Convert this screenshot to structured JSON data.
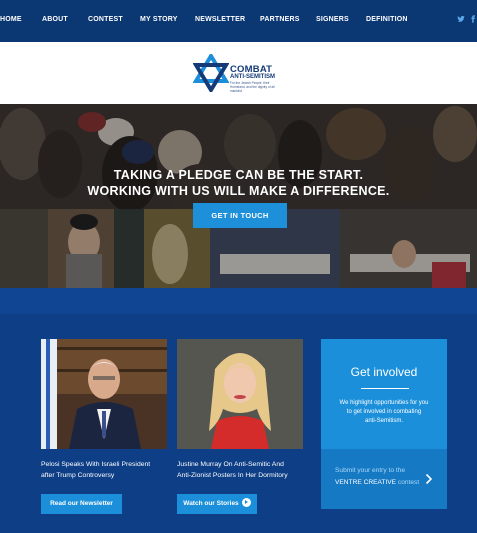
{
  "nav": {
    "items": [
      "HOME",
      "ABOUT",
      "CONTEST",
      "MY STORY",
      "NEWSLETTER",
      "PARTNERS",
      "SIGNERS",
      "DEFINITION"
    ],
    "social_icons": [
      "twitter-icon",
      "facebook-icon"
    ]
  },
  "logo": {
    "title": "COMBAT",
    "subtitle": "ANTI-SEMITISM",
    "tagline": "For the Jewish People, their Homeland, and the dignity of all mankind"
  },
  "hero": {
    "line1": "TAKING A PLEDGE CAN BE THE START.",
    "line2": "WORKING WITH US WILL MAKE A DIFFERENCE.",
    "cta": "GET IN TOUCH"
  },
  "cards": [
    {
      "caption_line1": "Pelosi Speaks With Israeli President",
      "caption_line2": "after Trump Controversy",
      "button": "Read our Newsletter"
    },
    {
      "caption_line1": "Justine Murray On Anti-Semitic And",
      "caption_line2": "Anti-Zionist Posters In Her Dormitory",
      "button": "Watch our Stories"
    }
  ],
  "get_involved": {
    "title": "Get involved",
    "text_line1": "We highlight opportunities for you",
    "text_line2": "to get involved in combating",
    "text_line3": "anti-Semitism.",
    "submit_line1": "Submit your entry to the",
    "submit_line2_a": "VENTRE CREATIVE",
    "submit_line2_b": "contest"
  },
  "colors": {
    "nav_bg": "#0b3773",
    "accent": "#1e8fd9",
    "brand_navy": "#143b78"
  }
}
